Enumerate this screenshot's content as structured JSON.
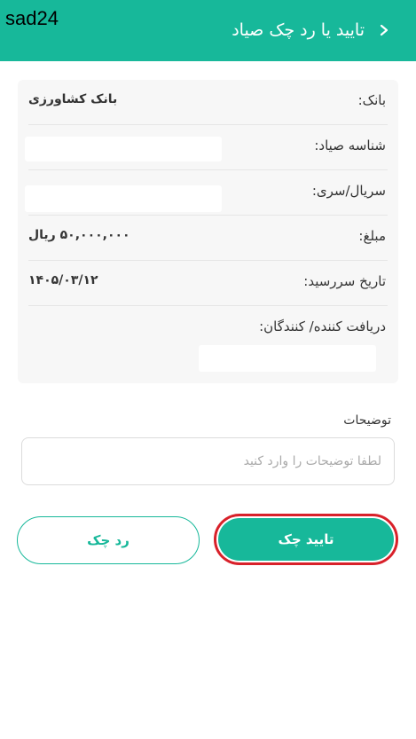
{
  "watermark": "sad24",
  "header": {
    "title": "تایید یا رد چک صیاد"
  },
  "details": {
    "bank_label": "بانک:",
    "bank_value": "بانک کشاورزی",
    "sayad_id_label": "شناسه صیاد:",
    "serial_label": "سریال/سری:",
    "amount_label": "مبلغ:",
    "amount_value": "۵۰,۰۰۰,۰۰۰ ریال",
    "due_date_label": "تاریخ سررسید:",
    "due_date_value": "۱۴۰۵/۰۳/۱۲",
    "receivers_label": "دریافت کننده/ کنندگان:"
  },
  "description": {
    "label": "توضیحات",
    "placeholder": "لطفا توضیحات را وارد کنید"
  },
  "actions": {
    "confirm_label": "تایید چک",
    "reject_label": "رد چک"
  },
  "colors": {
    "primary": "#17b89a",
    "highlight": "#d8212a"
  }
}
